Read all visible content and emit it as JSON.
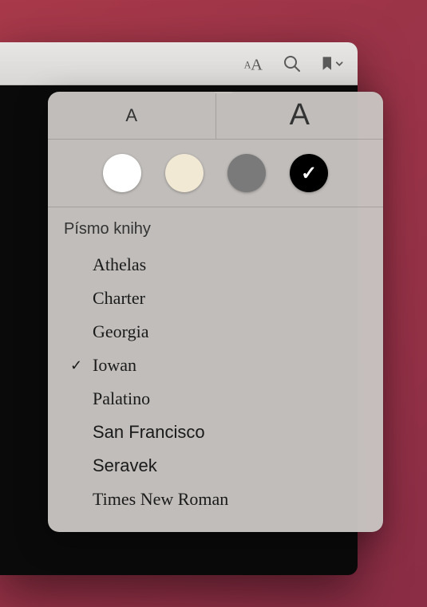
{
  "toolbar": {
    "appearance_btn": "Appearance",
    "search_btn": "Search",
    "bookmark_btn": "Bookmark"
  },
  "popover": {
    "size_small_glyph": "A",
    "size_large_glyph": "A",
    "themes": {
      "white": "#ffffff",
      "sepia": "#f2e9d5",
      "gray": "#7a7a7a",
      "night": "#000000",
      "selected": "night"
    },
    "font_header": "Písmo knihy",
    "fonts": [
      {
        "label": "Athelas",
        "class": "f-athelas",
        "selected": false
      },
      {
        "label": "Charter",
        "class": "f-charter",
        "selected": false
      },
      {
        "label": "Georgia",
        "class": "f-georgia",
        "selected": false
      },
      {
        "label": "Iowan",
        "class": "f-iowan",
        "selected": true
      },
      {
        "label": "Palatino",
        "class": "f-palatino",
        "selected": false
      },
      {
        "label": "San Francisco",
        "class": "f-sf",
        "selected": false
      },
      {
        "label": "Seravek",
        "class": "f-seravek",
        "selected": false
      },
      {
        "label": "Times New Roman",
        "class": "f-tnr",
        "selected": false
      }
    ],
    "checkmark_glyph": "✓"
  }
}
